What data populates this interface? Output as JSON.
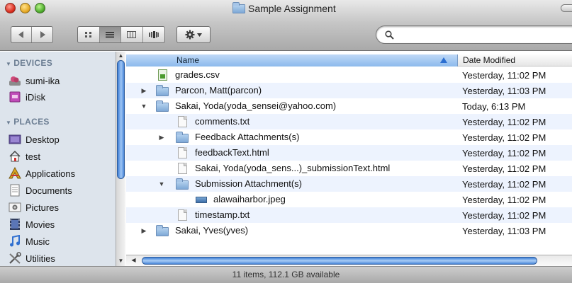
{
  "window": {
    "title": "Sample Assignment"
  },
  "search": {
    "value": "",
    "placeholder": ""
  },
  "sidebar": {
    "devices_header": "DEVICES",
    "places_header": "PLACES",
    "devices": [
      {
        "label": "sumi-ika",
        "icon": "user-disk-icon"
      },
      {
        "label": "iDisk",
        "icon": "idisk-icon"
      }
    ],
    "places": [
      {
        "label": "Desktop",
        "icon": "desktop-icon"
      },
      {
        "label": "test",
        "icon": "home-icon"
      },
      {
        "label": "Applications",
        "icon": "applications-icon"
      },
      {
        "label": "Documents",
        "icon": "documents-icon"
      },
      {
        "label": "Pictures",
        "icon": "pictures-icon"
      },
      {
        "label": "Movies",
        "icon": "movies-icon"
      },
      {
        "label": "Music",
        "icon": "music-icon"
      },
      {
        "label": "Utilities",
        "icon": "utilities-icon"
      }
    ]
  },
  "columns": {
    "name": "Name",
    "date": "Date Modified"
  },
  "files": [
    {
      "name": "grades.csv",
      "date": "Yesterday, 11:02 PM",
      "kind": "csv",
      "depth": 0,
      "disclosure": ""
    },
    {
      "name": "Parcon, Matt(parcon)",
      "date": "Yesterday, 11:03 PM",
      "kind": "folder",
      "depth": 0,
      "disclosure": "collapsed"
    },
    {
      "name": "Sakai, Yoda(yoda_sensei@yahoo.com)",
      "date": "Today, 6:13 PM",
      "kind": "folder",
      "depth": 0,
      "disclosure": "expanded"
    },
    {
      "name": "comments.txt",
      "date": "Yesterday, 11:02 PM",
      "kind": "doc",
      "depth": 1,
      "disclosure": ""
    },
    {
      "name": "Feedback Attachments(s)",
      "date": "Yesterday, 11:02 PM",
      "kind": "folder",
      "depth": 1,
      "disclosure": "collapsed"
    },
    {
      "name": "feedbackText.html",
      "date": "Yesterday, 11:02 PM",
      "kind": "doc",
      "depth": 1,
      "disclosure": ""
    },
    {
      "name": "Sakai, Yoda(yoda_sens...)_submissionText.html",
      "date": "Yesterday, 11:02 PM",
      "kind": "doc",
      "depth": 1,
      "disclosure": ""
    },
    {
      "name": "Submission Attachment(s)",
      "date": "Yesterday, 11:02 PM",
      "kind": "folder",
      "depth": 1,
      "disclosure": "expanded"
    },
    {
      "name": "alawaiharbor.jpeg",
      "date": "Yesterday, 11:02 PM",
      "kind": "jpeg",
      "depth": 2,
      "disclosure": ""
    },
    {
      "name": "timestamp.txt",
      "date": "Yesterday, 11:02 PM",
      "kind": "doc",
      "depth": 1,
      "disclosure": ""
    },
    {
      "name": "Sakai, Yves(yves)",
      "date": "Yesterday, 11:03 PM",
      "kind": "folder",
      "depth": 0,
      "disclosure": "collapsed"
    }
  ],
  "status": {
    "text": "11 items, 112.1 GB available"
  },
  "colors": {
    "sidebar_bg": "#dde4ec",
    "row_alt": "#edf3fe",
    "header_accent": "#8cbaec",
    "scroll_accent": "#3c7ed6"
  }
}
